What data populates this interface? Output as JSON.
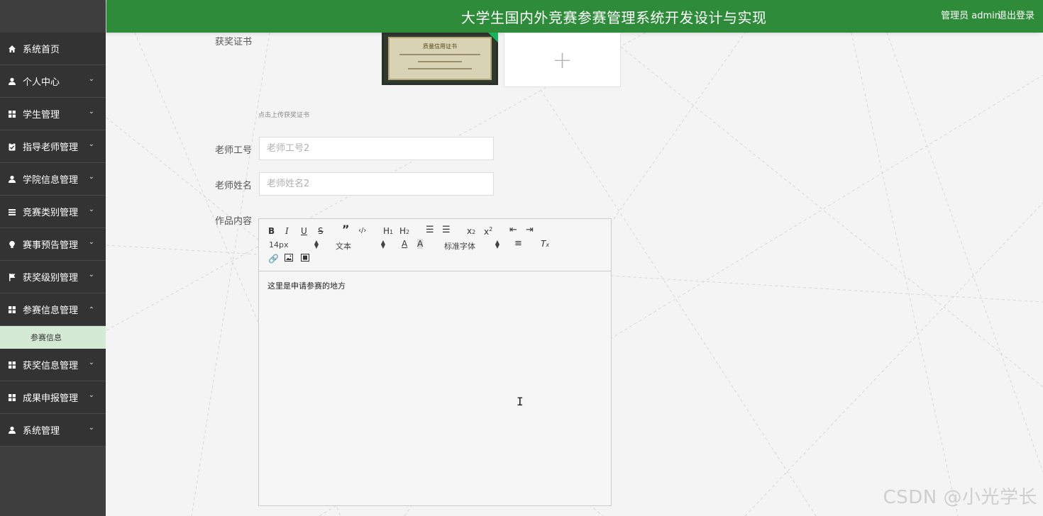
{
  "header": {
    "title": "大学生国内外竞赛参赛管理系统开发设计与实现",
    "user": "管理员 admin",
    "logout": "退出登录",
    "color": "#2e8b3a"
  },
  "sidebar": {
    "items": [
      {
        "label": "系统首页",
        "icon": "home-icon",
        "arrow": ""
      },
      {
        "label": "个人中心",
        "icon": "user-icon",
        "arrow": "⌄"
      },
      {
        "label": "学生管理",
        "icon": "grid-icon",
        "arrow": "⌄"
      },
      {
        "label": "指导老师管理",
        "icon": "clipboard-icon",
        "arrow": "⌄"
      },
      {
        "label": "学院信息管理",
        "icon": "user-icon",
        "arrow": "⌄"
      },
      {
        "label": "竞赛类别管理",
        "icon": "list-icon",
        "arrow": "⌄"
      },
      {
        "label": "赛事预告管理",
        "icon": "bulb-icon",
        "arrow": "⌄"
      },
      {
        "label": "获奖级别管理",
        "icon": "flag-icon",
        "arrow": "⌄"
      },
      {
        "label": "参赛信息管理",
        "icon": "grid-icon",
        "arrow": "⌃"
      },
      {
        "label": "获奖信息管理",
        "icon": "grid-icon",
        "arrow": "⌄"
      },
      {
        "label": "成果申报管理",
        "icon": "grid-icon",
        "arrow": "⌄"
      },
      {
        "label": "系统管理",
        "icon": "user-icon",
        "arrow": "⌄"
      }
    ],
    "sub_item": "参赛信息"
  },
  "form": {
    "certificate_label": "获奖证书",
    "certificate_image_title": "质量信用证书",
    "upload_hint": "点击上传获奖证书",
    "teacher_id_label": "老师工号",
    "teacher_id_placeholder": "老师工号2",
    "teacher_name_label": "老师姓名",
    "teacher_name_placeholder": "老师姓名2",
    "content_label": "作品内容"
  },
  "editor": {
    "font_size": "14px",
    "block_type": "文本",
    "font_family": "标准字体",
    "content": "这里是申请参赛的地方"
  },
  "watermark": "CSDN @小光学长"
}
